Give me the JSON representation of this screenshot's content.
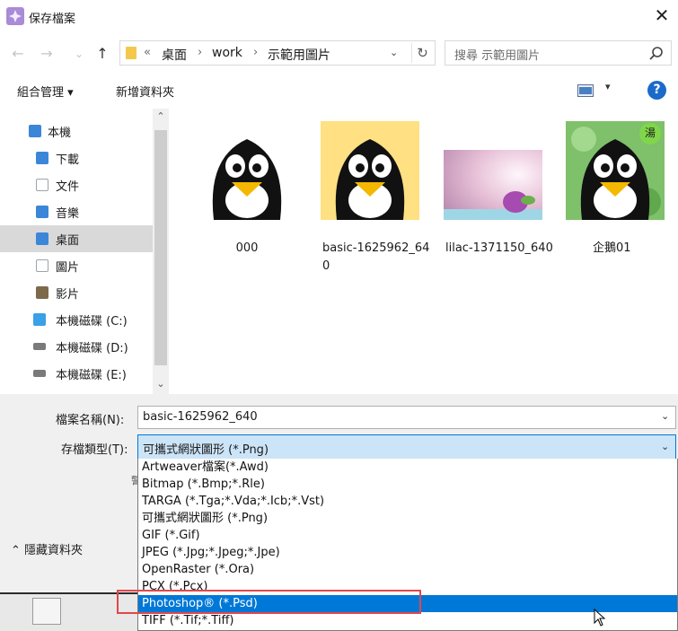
{
  "window": {
    "title": "保存檔案",
    "close_glyph": "✕"
  },
  "nav": {
    "back_glyph": "←",
    "forward_glyph": "→",
    "recent_glyph": "⌄",
    "up_glyph": "↑",
    "breadcrumb": [
      "桌面",
      "work",
      "示範用圖片"
    ],
    "breadcrumb_prefix": "«",
    "separator": "›",
    "refresh_glyph": "↻"
  },
  "search": {
    "placeholder": "搜尋 示範用圖片"
  },
  "toolbar": {
    "organize_label": "組合管理 ▾",
    "new_folder_label": "新增資料夾",
    "view_chevron": "▾",
    "help_label": "?"
  },
  "sidebar": {
    "items": [
      {
        "label": "本機",
        "icon": "computer-icon",
        "color": "#3b86d9"
      },
      {
        "label": "下載",
        "icon": "download-folder-icon",
        "color": "#3b86d9"
      },
      {
        "label": "文件",
        "icon": "documents-icon",
        "color": "#9aa3ad"
      },
      {
        "label": "音樂",
        "icon": "music-icon",
        "color": "#3b86d9"
      },
      {
        "label": "桌面",
        "icon": "desktop-icon",
        "color": "#3b86d9"
      },
      {
        "label": "圖片",
        "icon": "pictures-icon",
        "color": "#9aa3ad"
      },
      {
        "label": "影片",
        "icon": "videos-icon",
        "color": "#7d6a4a"
      },
      {
        "label": "本機磁碟 (C:)",
        "icon": "windows-drive-icon",
        "color": "#3aa0e8"
      },
      {
        "label": "本機磁碟 (D:)",
        "icon": "drive-icon",
        "color": "#7a7a7a"
      },
      {
        "label": "本機磁碟 (E:)",
        "icon": "drive-icon",
        "color": "#7a7a7a"
      }
    ],
    "selected_index": 4,
    "scroll_up": "⌃",
    "scroll_down": "⌄"
  },
  "files": [
    {
      "name": "000",
      "type": "penguin",
      "bg": "#ffffff"
    },
    {
      "name": "basic-1625962_640",
      "type": "penguin",
      "bg": "#ffe082"
    },
    {
      "name": "lilac-1371150_640",
      "type": "lilac",
      "bg": "#e8c6d8"
    },
    {
      "name": "企鵝01",
      "type": "penguin-leaf",
      "bg": "#7fc06a",
      "badge": "湯"
    }
  ],
  "form": {
    "filename_label": "檔案名稱(N):",
    "filename_value": "basic-1625962_640",
    "filetype_label": "存檔類型(T):",
    "filetype_value": "可攜式網狀圖形 (*.Png)",
    "chevron": "⌄",
    "peek_char": "警"
  },
  "hide_folders_label": "⌃  隱藏資料夾",
  "dropdown": {
    "options": [
      "Artweaver檔案(*.Awd)",
      "Bitmap (*.Bmp;*.Rle)",
      "TARGA (*.Tga;*.Vda;*.Icb;*.Vst)",
      "可攜式網狀圖形 (*.Png)",
      "GIF (*.Gif)",
      "JPEG (*.Jpg;*.Jpeg;*.Jpe)",
      "OpenRaster (*.Ora)",
      "PCX (*.Pcx)",
      "Photoshop® (*.Psd)",
      "TIFF (*.Tif;*.Tiff)"
    ],
    "highlighted_index": 8
  },
  "colors": {
    "accent": "#0078d7",
    "annotation": "#e0474c"
  }
}
